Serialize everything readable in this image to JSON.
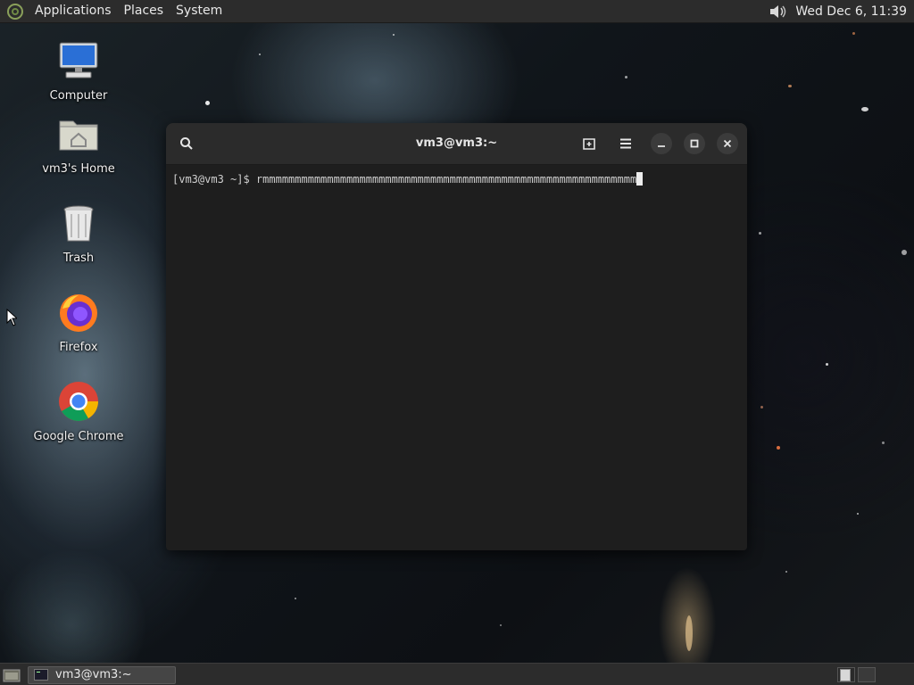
{
  "top_panel": {
    "menus": [
      "Applications",
      "Places",
      "System"
    ],
    "clock": "Wed Dec  6, 11:39",
    "icons": {
      "logo": "distro-logo-icon",
      "volume": "volume-icon"
    }
  },
  "desktop": {
    "icons": [
      {
        "label": "Computer",
        "icon": "computer-icon"
      },
      {
        "label": "vm3's Home",
        "icon": "home-folder-icon"
      },
      {
        "label": "Trash",
        "icon": "trash-icon"
      },
      {
        "label": "Firefox",
        "icon": "firefox-icon"
      },
      {
        "label": "Google Chrome",
        "icon": "chrome-icon"
      }
    ]
  },
  "terminal": {
    "title": "vm3@vm3:~",
    "prompt": "[vm3@vm3 ~]$ ",
    "command": "rmmmmmmmmmmmmmmmmmmmmmmmmmmmmmmmmmmmmmmmmmmmmmmmmmmmmmmmmmm",
    "header_icons": [
      "search-icon",
      "new-tab-icon",
      "hamburger-menu-icon",
      "minimize-icon",
      "maximize-icon",
      "close-icon"
    ]
  },
  "bottom_panel": {
    "task": "vm3@vm3:~",
    "workspaces": 2,
    "icons": {
      "show_desktop": "show-desktop-icon",
      "terminal": "terminal-icon"
    }
  },
  "colors": {
    "panel": "#2c2c2c",
    "terminal_bg": "#1e1e1e",
    "header_bg": "#2b2b2b"
  }
}
